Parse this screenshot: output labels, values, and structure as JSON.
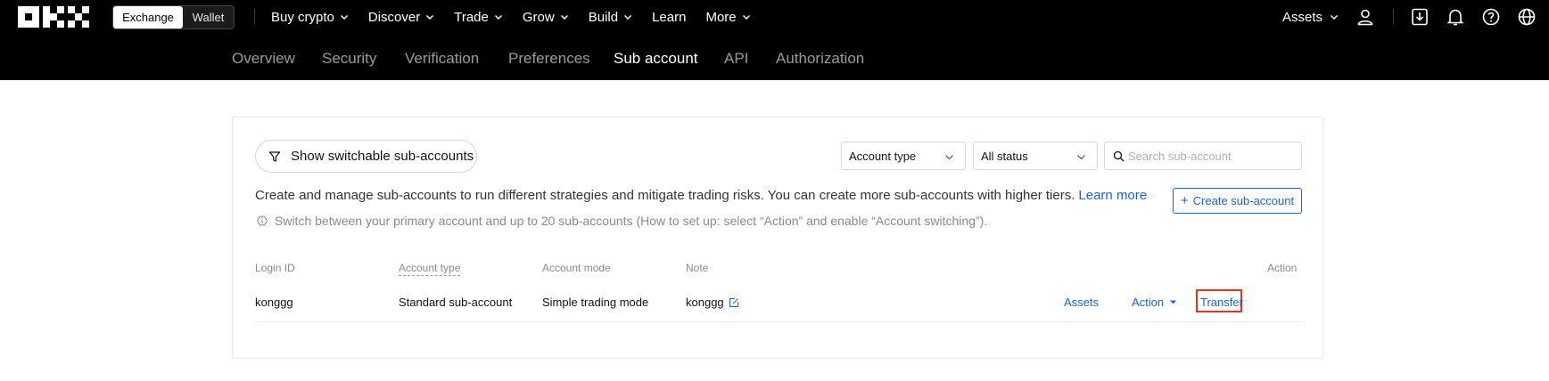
{
  "topbar": {
    "mode_switch": {
      "exchange": "Exchange",
      "wallet": "Wallet"
    },
    "nav": [
      {
        "label": "Buy crypto",
        "has_dropdown": true
      },
      {
        "label": "Discover",
        "has_dropdown": true
      },
      {
        "label": "Trade",
        "has_dropdown": true
      },
      {
        "label": "Grow",
        "has_dropdown": true
      },
      {
        "label": "Build",
        "has_dropdown": true
      },
      {
        "label": "Learn",
        "has_dropdown": false
      },
      {
        "label": "More",
        "has_dropdown": true
      }
    ],
    "assets_label": "Assets",
    "icons": [
      "user-icon",
      "download-icon",
      "bell-icon",
      "help-icon",
      "globe-icon"
    ]
  },
  "subnav": {
    "tabs": [
      {
        "label": "Overview",
        "active": false
      },
      {
        "label": "Security",
        "active": false
      },
      {
        "label": "Verification",
        "active": false
      },
      {
        "label": "Preferences",
        "active": false
      },
      {
        "label": "Sub account",
        "active": true
      },
      {
        "label": "API",
        "active": false
      },
      {
        "label": "Authorization",
        "active": false
      }
    ]
  },
  "filters": {
    "switchable_label": "Show switchable sub-accounts",
    "account_type": "Account type",
    "status": "All status",
    "search_placeholder": "Search sub-account"
  },
  "intro": {
    "description": "Create and manage sub-accounts to run different strategies and mitigate trading risks. You can create more sub-accounts with higher tiers.",
    "learn_more": "Learn more",
    "note": "Switch between your primary account and up to 20 sub-accounts (How to set up: select “Action” and enable “Account switching”).",
    "create_label": "Create sub-account"
  },
  "table": {
    "headers": {
      "login_id": "Login ID",
      "account_type": "Account type",
      "account_mode": "Account mode",
      "note": "Note",
      "action": "Action"
    },
    "rows": [
      {
        "login_id": "konggg",
        "account_type": "Standard sub-account",
        "account_mode": "Simple trading mode",
        "note": "konggg",
        "actions": {
          "assets": "Assets",
          "transfer": "Transfer",
          "action": "Action"
        }
      }
    ]
  },
  "colors": {
    "header_bg": "#000000",
    "accent_link": "#1c62d8",
    "highlight_box": "#e0341e"
  }
}
